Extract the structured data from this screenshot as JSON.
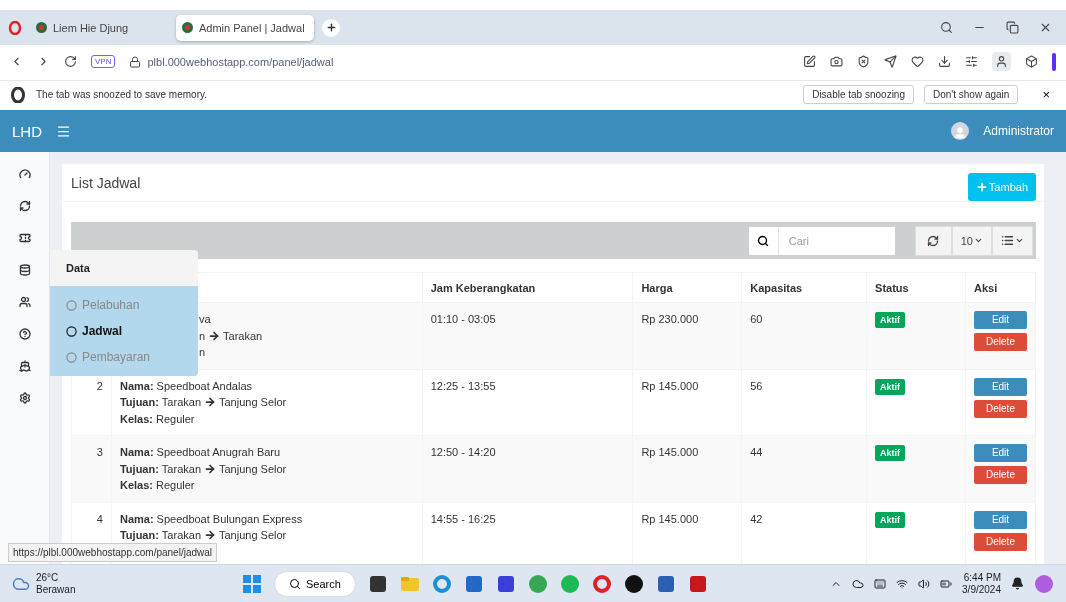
{
  "browser": {
    "tabs": [
      {
        "title": "Liem Hie Djung",
        "selected": false
      },
      {
        "title": "Admin Panel | Jadwal",
        "selected": true
      }
    ],
    "vpn": "VPN",
    "url": "plbl.000webhostapp.com/panel/jadwal"
  },
  "snooze_bar": {
    "message": "The tab was snoozed to save memory.",
    "buttons": [
      "Disable tab snoozing",
      "Don't show again"
    ],
    "close": "×"
  },
  "header": {
    "brand": "LHD",
    "user": "Administrator"
  },
  "flyout": {
    "title": "Data",
    "items": [
      {
        "label": "Pelabuhan",
        "selected": false
      },
      {
        "label": "Jadwal",
        "selected": true
      },
      {
        "label": "Pembayaran",
        "selected": false
      }
    ]
  },
  "card": {
    "title": "List Jadwal",
    "add_button": "Tambah",
    "search": {
      "placeholder": "Cari"
    },
    "page_size": "10"
  },
  "table": {
    "columns": [
      "Jam Keberangkatan",
      "Harga",
      "Kapasitas",
      "Status",
      "Aksi"
    ],
    "rows": [
      {
        "lines": [
          {
            "value": "va"
          },
          {
            "from": "n",
            "to": "Tarakan"
          },
          {
            "value": "n"
          }
        ],
        "jam": "01:10 - 03:05",
        "harga": "Rp 230.000",
        "kapasitas": "60",
        "status": "Aktif",
        "actions": [
          "Edit",
          "Delete"
        ]
      },
      {
        "no": "2",
        "lines": [
          {
            "label": "Nama:",
            "value": "Speedboat Andalas"
          },
          {
            "label": "Tujuan:",
            "from": "Tarakan",
            "to": "Tanjung Selor"
          },
          {
            "label": "Kelas:",
            "value": "Reguler"
          }
        ],
        "jam": "12:25 - 13:55",
        "harga": "Rp 145.000",
        "kapasitas": "56",
        "status": "Aktif",
        "actions": [
          "Edit",
          "Delete"
        ]
      },
      {
        "no": "3",
        "lines": [
          {
            "label": "Nama:",
            "value": "Speedboat Anugrah Baru"
          },
          {
            "label": "Tujuan:",
            "from": "Tarakan",
            "to": "Tanjung Selor"
          },
          {
            "label": "Kelas:",
            "value": "Reguler"
          }
        ],
        "jam": "12:50 - 14:20",
        "harga": "Rp 145.000",
        "kapasitas": "44",
        "status": "Aktif",
        "actions": [
          "Edit",
          "Delete"
        ]
      },
      {
        "no": "4",
        "lines": [
          {
            "label": "Nama:",
            "value": "Speedboat Bulungan Express"
          },
          {
            "label": "Tujuan:",
            "from": "Tarakan",
            "to": "Tanjung Selor"
          }
        ],
        "jam": "14:55 - 16:25",
        "harga": "Rp 145.000",
        "kapasitas": "42",
        "status": "Aktif",
        "actions": [
          "Edit",
          "Delete"
        ]
      }
    ]
  },
  "status_url": "https://plbl.000webhostapp.com/panel/jadwal",
  "taskbar": {
    "weather": {
      "temp": "26°C",
      "condition": "Berawan"
    },
    "search": "Search",
    "time": "6:44 PM",
    "date": "3/9/2024"
  }
}
